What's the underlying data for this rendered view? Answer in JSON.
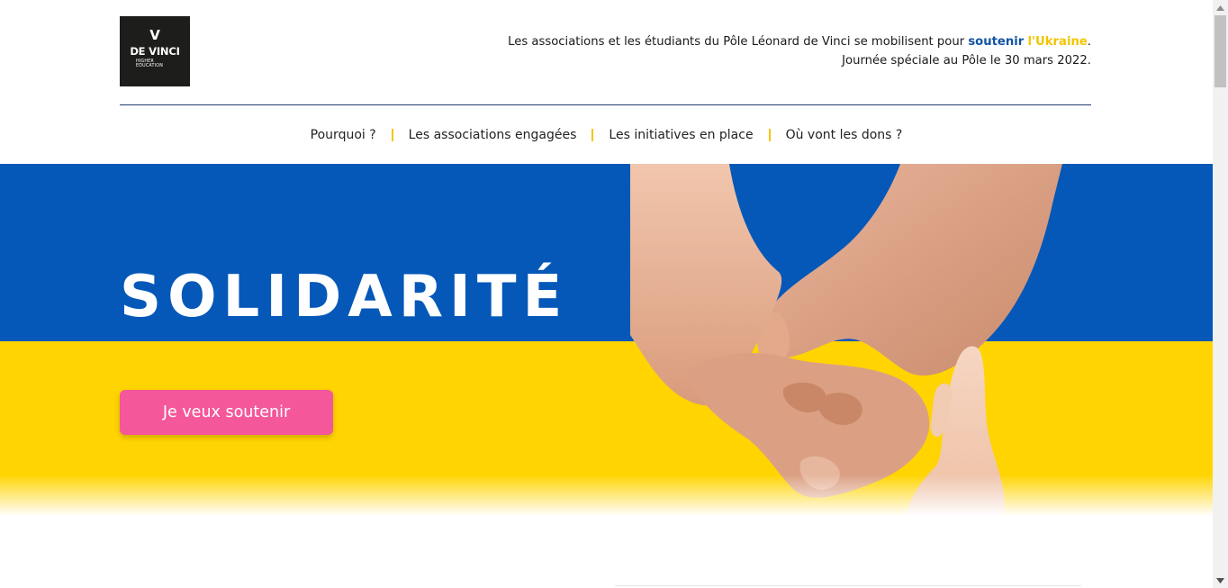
{
  "logo": {
    "mark": "V",
    "name": "DE VINCI",
    "sub_line1": "HIGHER",
    "sub_line2": "EDUCATION"
  },
  "header": {
    "tagline_part1": "Les associations et les étudiants du Pôle Léonard de Vinci se mobilisent pour ",
    "tagline_blue": "soutenir",
    "tagline_space": " ",
    "tagline_yellow": "l'Ukraine",
    "tagline_end": ".",
    "tagline_line2": "Journée spéciale au Pôle le 30 mars 2022."
  },
  "nav": {
    "items": [
      {
        "label": "Pourquoi ?"
      },
      {
        "label": "Les associations engagées"
      },
      {
        "label": "Les initiatives en place"
      },
      {
        "label": "Où vont les dons ?"
      }
    ]
  },
  "hero": {
    "title": "SOLIDARITÉ",
    "cta_label": "Je veux soutenir"
  },
  "colors": {
    "ukraine_blue": "#0558b8",
    "ukraine_yellow": "#ffd400",
    "cta_pink": "#f4579a",
    "nav_separator": "#f6c500",
    "link_blue": "#1253a3"
  }
}
